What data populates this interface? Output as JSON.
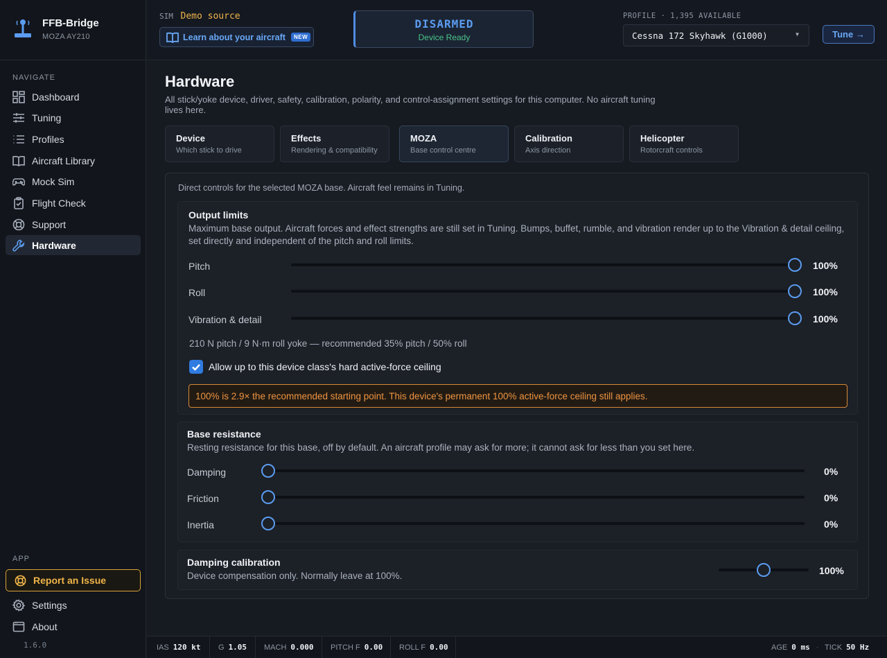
{
  "brand": {
    "name": "FFB-Bridge",
    "device": "MOZA AY210"
  },
  "sidebar": {
    "navigate_label": "NAVIGATE",
    "items": [
      {
        "label": "Dashboard",
        "icon": "dashboard-icon"
      },
      {
        "label": "Tuning",
        "icon": "sliders-icon"
      },
      {
        "label": "Profiles",
        "icon": "list-icon"
      },
      {
        "label": "Aircraft Library",
        "icon": "book-icon"
      },
      {
        "label": "Mock Sim",
        "icon": "gamepad-icon"
      },
      {
        "label": "Flight Check",
        "icon": "clipboard-check-icon"
      },
      {
        "label": "Support",
        "icon": "lifebuoy-icon"
      },
      {
        "label": "Hardware",
        "icon": "wrench-icon",
        "active": true
      }
    ],
    "app_label": "APP",
    "report": "Report an Issue",
    "settings": "Settings",
    "about": "About",
    "version": "1.6.0"
  },
  "topbar": {
    "sim_label": "SIM",
    "sim_source": "Demo source",
    "learn": "Learn about your aircraft",
    "new_badge": "NEW",
    "arm_state": "DISARMED",
    "arm_sub": "Device Ready",
    "profile_label": "PROFILE · 1,395 AVAILABLE",
    "profile_value": "Cessna 172 Skyhawk (G1000)",
    "tune": "Tune →"
  },
  "page": {
    "title": "Hardware",
    "description": "All stick/yoke device, driver, safety, calibration, polarity, and control-assignment settings for this computer. No aircraft tuning lives here."
  },
  "tabs": [
    {
      "title": "Device",
      "sub": "Which stick to drive"
    },
    {
      "title": "Effects",
      "sub": "Rendering & compatibility"
    },
    {
      "title": "MOZA",
      "sub": "Base control centre",
      "active": true
    },
    {
      "title": "Calibration",
      "sub": "Axis direction"
    },
    {
      "title": "Helicopter",
      "sub": "Rotorcraft controls"
    }
  ],
  "panel": {
    "intro": "Direct controls for the selected MOZA base. Aircraft feel remains in Tuning.",
    "output_limits": {
      "title": "Output limits",
      "description": "Maximum base output. Aircraft forces and effect strengths are still set in Tuning. Bumps, buffet, rumble, and vibration render up to the Vibration & detail ceiling, set directly and independent of the pitch and roll limits.",
      "sliders": [
        {
          "label": "Pitch",
          "value_text": "100%",
          "fraction": 1.0
        },
        {
          "label": "Roll",
          "value_text": "100%",
          "fraction": 1.0
        },
        {
          "label": "Vibration & detail",
          "value_text": "100%",
          "fraction": 1.0
        }
      ],
      "recommendation": "210 N pitch / 9 N·m roll yoke — recommended 35% pitch / 50% roll",
      "checkbox_label": "Allow up to this device class's hard active-force ceiling",
      "checkbox_checked": true,
      "warning": "100% is 2.9× the recommended starting point. This device's permanent 100% active-force ceiling still applies."
    },
    "base_resistance": {
      "title": "Base resistance",
      "description": "Resting resistance for this base, off by default. An aircraft profile may ask for more; it cannot ask for less than you set here.",
      "sliders": [
        {
          "label": "Damping",
          "value_text": "0%",
          "fraction": 0.0
        },
        {
          "label": "Friction",
          "value_text": "0%",
          "fraction": 0.0
        },
        {
          "label": "Inertia",
          "value_text": "0%",
          "fraction": 0.0
        }
      ]
    },
    "damping_calibration": {
      "title": "Damping calibration",
      "description": "Device compensation only. Normally leave at 100%.",
      "value_text": "100%",
      "fraction": 0.5
    }
  },
  "status": {
    "ias_label": "IAS",
    "ias": "120 kt",
    "g_label": "G",
    "g": "1.05",
    "mach_label": "MACH",
    "mach": "0.000",
    "pitchf_label": "PITCH F",
    "pitchf": "0.00",
    "rollf_label": "ROLL F",
    "rollf": "0.00",
    "age_label": "AGE",
    "age": "0 ms",
    "tick_label": "TICK",
    "tick": "50 Hz"
  },
  "colors": {
    "accent": "#5b9cf0",
    "warning": "#ee9440",
    "ready": "#4cc38a",
    "report": "#f0b54a"
  }
}
